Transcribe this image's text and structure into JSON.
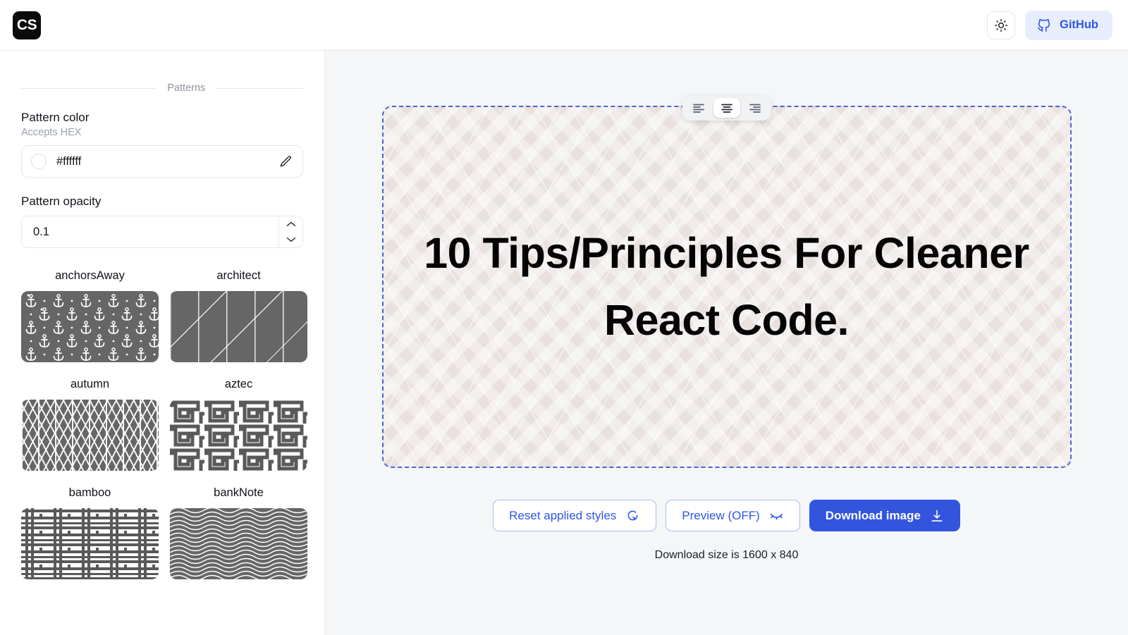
{
  "header": {
    "logo_text": "CS",
    "theme_toggle_icon": "sun-icon",
    "github_label": "GitHub",
    "github_icon": "github-icon"
  },
  "sidebar": {
    "section_title": "Patterns",
    "pattern_color": {
      "label": "Pattern color",
      "hint": "Accepts HEX",
      "value": "#ffffff",
      "swatch_color": "#ffffff",
      "edit_icon": "pencil-icon"
    },
    "pattern_opacity": {
      "label": "Pattern opacity",
      "value": "0.1",
      "increment_icon": "chevron-up-icon",
      "decrement_icon": "chevron-down-icon"
    },
    "patterns": [
      {
        "name": "anchorsAway"
      },
      {
        "name": "architect"
      },
      {
        "name": "autumn"
      },
      {
        "name": "aztec"
      },
      {
        "name": "bamboo"
      },
      {
        "name": "bankNote"
      }
    ],
    "thumb_background": "#666666",
    "thumb_foreground": "#ffffff"
  },
  "canvas": {
    "title": "10 Tips/Principles For Cleaner React Code.",
    "background_color": "#e9e1de",
    "border_color": "#4a63d8",
    "align_options": [
      {
        "id": "left",
        "icon": "align-left-icon",
        "active": false
      },
      {
        "id": "center",
        "icon": "align-center-icon",
        "active": true
      },
      {
        "id": "right",
        "icon": "align-right-icon",
        "active": false
      }
    ]
  },
  "actions": {
    "reset_label": "Reset applied styles",
    "reset_icon": "rotate-ccw-icon",
    "preview_label": "Preview (OFF)",
    "preview_icon": "eye-off-icon",
    "download_label": "Download image",
    "download_icon": "download-icon",
    "primary_color": "#3355dd",
    "accent_color": "#2f55e5"
  },
  "footer": {
    "download_note": "Download size is 1600 x 840"
  }
}
